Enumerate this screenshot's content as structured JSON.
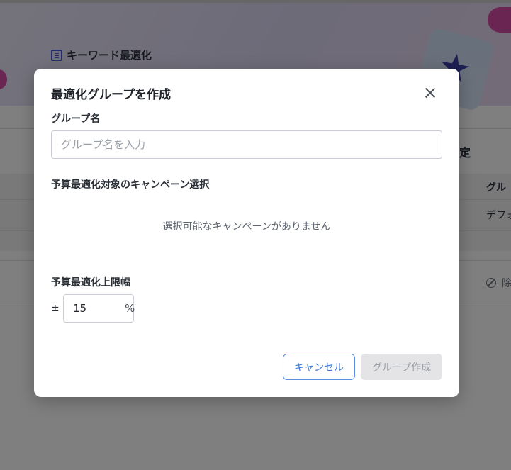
{
  "background": {
    "banner_title": "キーワード最適化",
    "header_right_fragment": "定",
    "column_header_fragment": "グル",
    "column_value_fragment": "デフォ",
    "row_action_fragment": "除"
  },
  "modal": {
    "title": "最適化グループを作成",
    "group_name_label": "グループ名",
    "group_name_placeholder": "グループ名を入力",
    "group_name_value": "",
    "campaign_section_label": "予算最適化対象のキャンペーン選択",
    "campaign_empty_message": "選択可能なキャンペーンがありません",
    "limit_label": "予算最適化上限幅",
    "limit_prefix": "±",
    "limit_value": "15",
    "limit_unit": "%",
    "cancel_label": "キャンセル",
    "create_label": "グループ作成"
  },
  "colors": {
    "accent_blue": "#3a78d8",
    "disabled_button_bg": "#e4e4e6",
    "overlay": "rgba(0,0,0,0.5)"
  },
  "icons": {
    "close": "close-icon",
    "banner": "list-icon",
    "action": "ban-icon"
  }
}
